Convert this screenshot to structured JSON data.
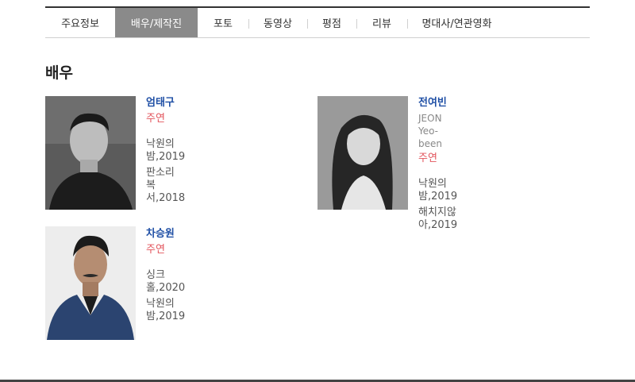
{
  "tabs": [
    {
      "label": "주요정보",
      "active": false
    },
    {
      "label": "배우/제작진",
      "active": true
    },
    {
      "label": "포토",
      "active": false
    },
    {
      "label": "동영상",
      "active": false
    },
    {
      "label": "평점",
      "active": false
    },
    {
      "label": "리뷰",
      "active": false
    },
    {
      "label": "명대사/연관영화",
      "active": false
    }
  ],
  "section_title": "배우",
  "actors": [
    {
      "name": "엄태구",
      "english_name": "",
      "role": "주연",
      "films": [
        "낙원의 밤,2019",
        "판소리 복서,2018"
      ]
    },
    {
      "name": "전여빈",
      "english_name": "JEON Yeo-been",
      "role": "주연",
      "films": [
        "낙원의 밤,2019",
        "해치지않아,2019"
      ]
    },
    {
      "name": "차승원",
      "english_name": "",
      "role": "주연",
      "films": [
        "싱크홀,2020",
        "낙원의 밤,2019"
      ]
    }
  ],
  "colors": {
    "name": "#1f4fa5",
    "role": "#e2545c",
    "active_tab_bg": "#8a8a8a"
  }
}
